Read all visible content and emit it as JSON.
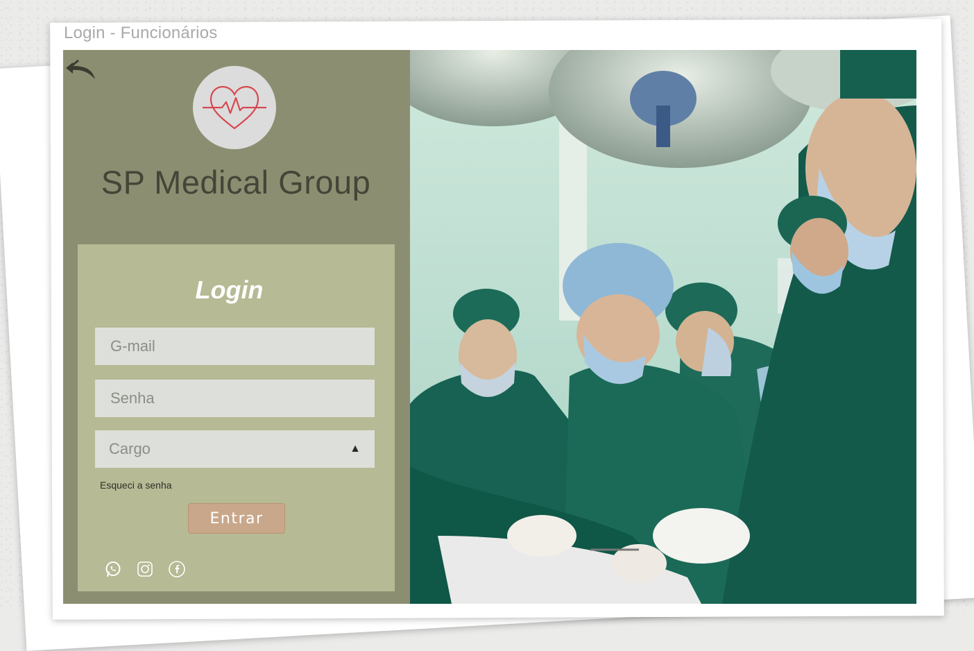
{
  "window": {
    "title": "Login - Funcionários"
  },
  "brand": {
    "name": "SP Medical Group"
  },
  "login": {
    "heading": "Login",
    "email_placeholder": "G-mail",
    "password_placeholder": "Senha",
    "role_select": {
      "selected": "Cargo",
      "caret": "▲"
    },
    "forgot_label": "Esqueci a senha",
    "submit_label": "Entrar"
  },
  "social": [
    "whatsapp-icon",
    "instagram-icon",
    "facebook-icon"
  ],
  "icons": {
    "back": "double-back-arrow-icon",
    "logo": "heart-pulse-icon",
    "photo": "surgeons-operating-room-photo"
  },
  "colors": {
    "panel": "#8c8e72",
    "card": "#b6ba95",
    "field": "#dde0da",
    "button": "#c9a78a",
    "logo_accent": "#d6484f",
    "surgical_green": "#1e6b5a"
  }
}
